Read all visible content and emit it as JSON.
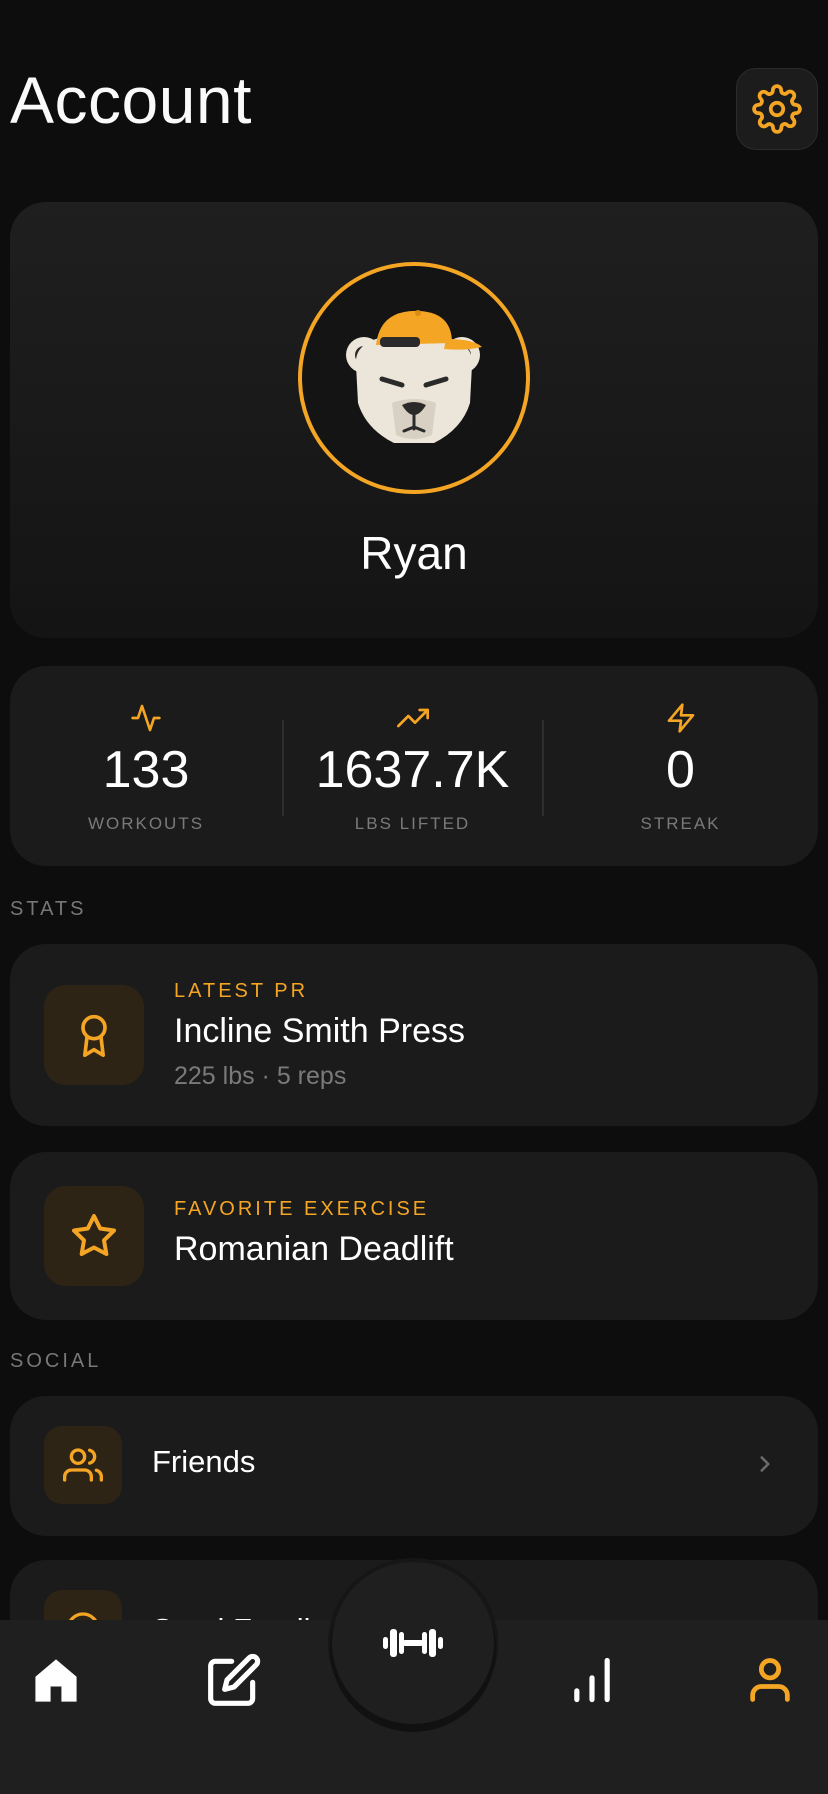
{
  "header": {
    "title": "Account",
    "settings_icon": "gear-icon"
  },
  "profile": {
    "name": "Ryan",
    "avatar_icon": "bear-with-cap-icon"
  },
  "stats": [
    {
      "icon": "activity-icon",
      "value": "133",
      "label": "WORKOUTS"
    },
    {
      "icon": "trending-up-icon",
      "value": "1637.7K",
      "label": "LBS LIFTED"
    },
    {
      "icon": "lightning-icon",
      "value": "0",
      "label": "STREAK"
    }
  ],
  "sections": {
    "stats_label": "STATS",
    "social_label": "SOCIAL"
  },
  "latest_pr": {
    "eyebrow": "LATEST PR",
    "title": "Incline Smith Press",
    "subtitle": "225 lbs · 5 reps",
    "icon": "award-icon"
  },
  "favorite": {
    "eyebrow": "FAVORITE EXERCISE",
    "title": "Romanian Deadlift",
    "icon": "star-icon"
  },
  "social": {
    "friends_label": "Friends",
    "friends_icon": "users-icon",
    "partial_label": "Send Feedback"
  },
  "tabbar": {
    "items": [
      "home-icon",
      "edit-icon",
      "dumbbell-icon",
      "bar-chart-icon",
      "user-icon"
    ],
    "active": "user-icon"
  },
  "colors": {
    "accent": "#f5a524",
    "background": "#0d0d0d",
    "card": "#1b1b1b",
    "muted": "#7a7a7a"
  }
}
